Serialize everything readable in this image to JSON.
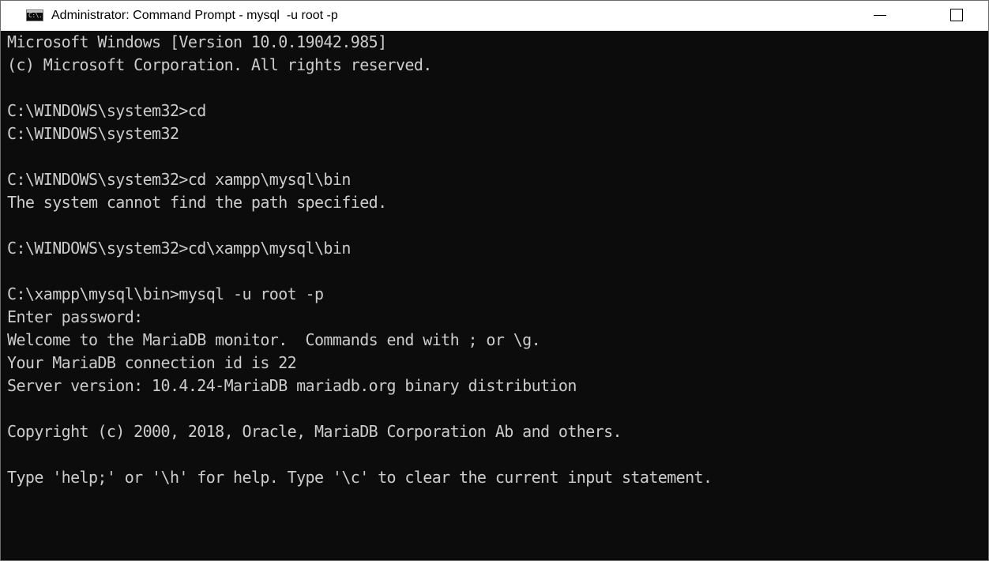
{
  "window": {
    "title": "Administrator: Command Prompt - mysql  -u root -p",
    "icon": "cmd-console-icon",
    "icon_text": "C:\\.",
    "controls": [
      "minimize",
      "maximize"
    ]
  },
  "console": {
    "text_color": "#cccccc",
    "background": "#0c0c0c",
    "lines": [
      "Microsoft Windows [Version 10.0.19042.985]",
      "(c) Microsoft Corporation. All rights reserved.",
      "",
      "C:\\WINDOWS\\system32>cd",
      "C:\\WINDOWS\\system32",
      "",
      "C:\\WINDOWS\\system32>cd xampp\\mysql\\bin",
      "The system cannot find the path specified.",
      "",
      "C:\\WINDOWS\\system32>cd\\xampp\\mysql\\bin",
      "",
      "C:\\xampp\\mysql\\bin>mysql -u root -p",
      "Enter password:",
      "Welcome to the MariaDB monitor.  Commands end with ; or \\g.",
      "Your MariaDB connection id is 22",
      "Server version: 10.4.24-MariaDB mariadb.org binary distribution",
      "",
      "Copyright (c) 2000, 2018, Oracle, MariaDB Corporation Ab and others.",
      "",
      "Type 'help;' or '\\h' for help. Type '\\c' to clear the current input statement."
    ]
  }
}
